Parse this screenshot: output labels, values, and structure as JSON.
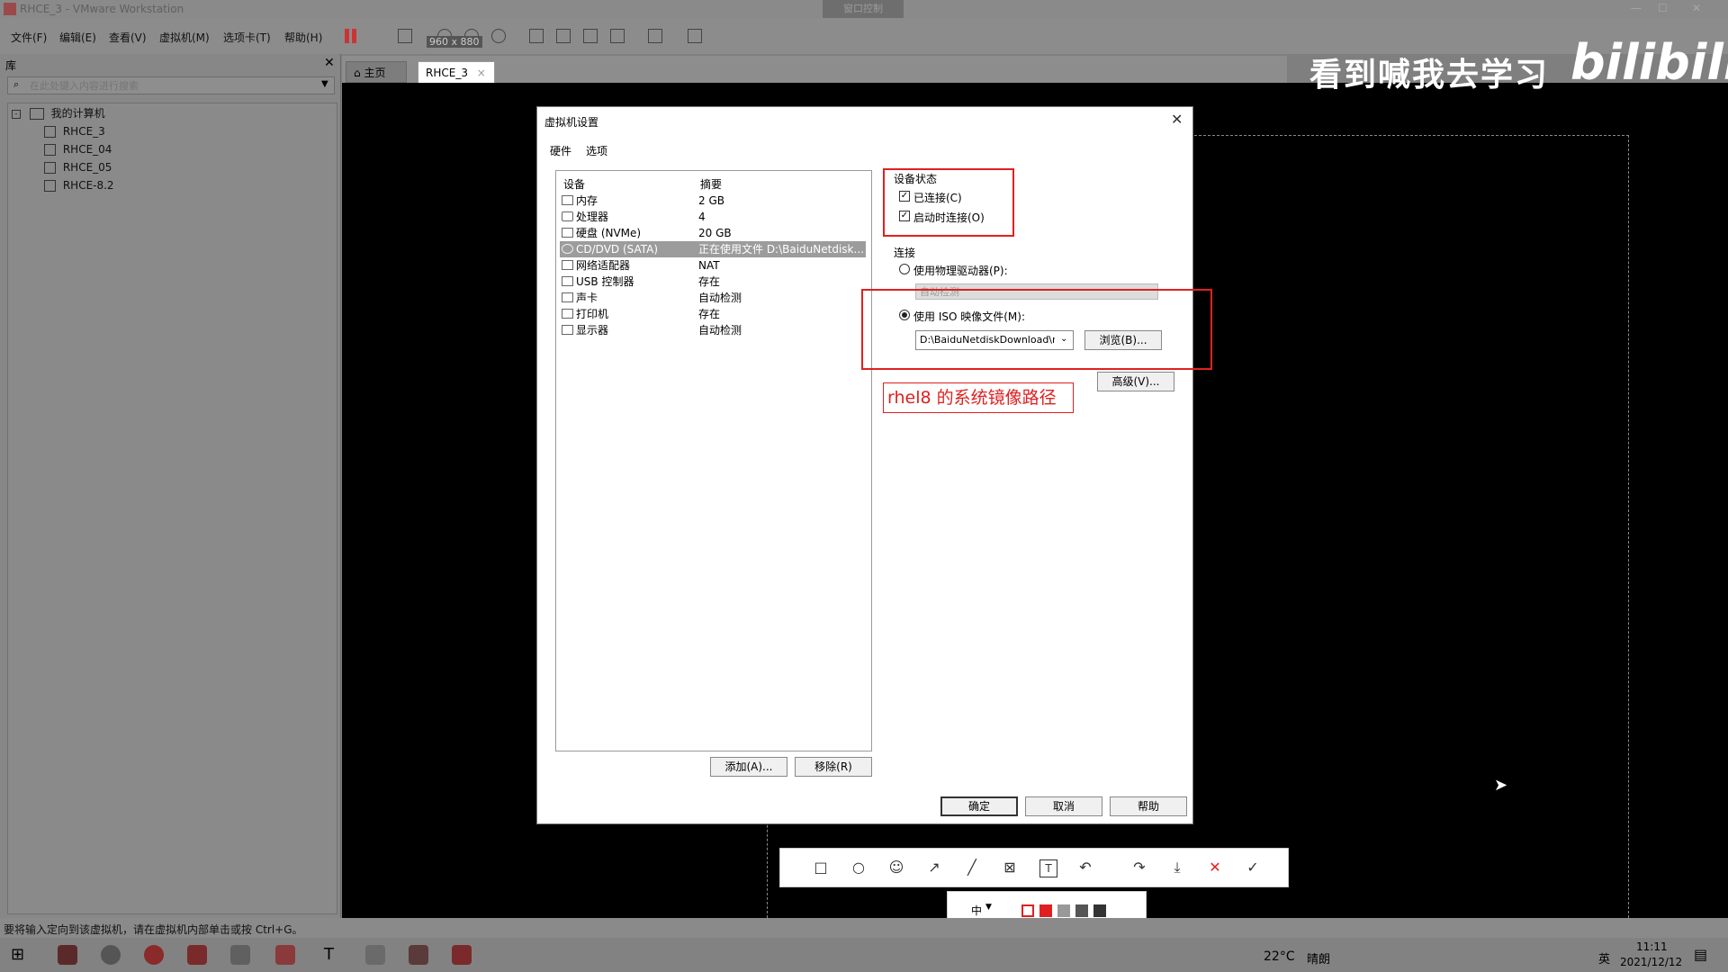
{
  "window": {
    "title": "RHCE_3 - VMware Workstation",
    "center_tab": "窗口控制"
  },
  "menu": [
    "文件(F)",
    "编辑(E)",
    "查看(V)",
    "虚拟机(M)",
    "选项卡(T)",
    "帮助(H)"
  ],
  "library": {
    "header": "库",
    "search_placeholder": "在此处键入内容进行搜索",
    "root": "我的计算机",
    "vms": [
      "RHCE_3",
      "RHCE_04",
      "RHCE_05",
      "RHCE-8.2"
    ]
  },
  "tabs": {
    "home": "主页",
    "vm": "RHCE_3"
  },
  "capture_size": "960 x 880",
  "watermark": {
    "text": "看到喊我去学习",
    "logo": "bilibili"
  },
  "dialog": {
    "title": "虚拟机设置",
    "tabs": [
      "硬件",
      "选项"
    ],
    "columns": {
      "device": "设备",
      "summary": "摘要"
    },
    "devices": [
      {
        "name": "内存",
        "summary": "2 GB",
        "icon": "memory-icon"
      },
      {
        "name": "处理器",
        "summary": "4",
        "icon": "cpu-icon"
      },
      {
        "name": "硬盘 (NVMe)",
        "summary": "20 GB",
        "icon": "disk-icon"
      },
      {
        "name": "CD/DVD (SATA)",
        "summary": "正在使用文件 D:\\BaiduNetdisk...",
        "icon": "cd-icon"
      },
      {
        "name": "网络适配器",
        "summary": "NAT",
        "icon": "network-icon"
      },
      {
        "name": "USB 控制器",
        "summary": "存在",
        "icon": "usb-icon"
      },
      {
        "name": "声卡",
        "summary": "自动检测",
        "icon": "sound-icon"
      },
      {
        "name": "打印机",
        "summary": "存在",
        "icon": "printer-icon"
      },
      {
        "name": "显示器",
        "summary": "自动检测",
        "icon": "display-icon"
      }
    ],
    "add_button": "添加(A)...",
    "remove_button": "移除(R)",
    "device_status_label": "设备状态",
    "connected_label": "已连接(C)",
    "connect_at_power_on_label": "启动时连接(O)",
    "connection_label": "连接",
    "use_physical_label": "使用物理驱动器(P):",
    "physical_value": "自动检测",
    "use_iso_label": "使用 ISO 映像文件(M):",
    "iso_path": "D:\\BaiduNetdiskDownload\\rh",
    "browse_button": "浏览(B)...",
    "advanced_button": "高级(V)...",
    "annotation": "rhel8 的系统镜像路径",
    "ok_button": "确定",
    "cancel_button": "取消",
    "help_button": "帮助"
  },
  "screenshot_tool": {
    "font_size_label": "中"
  },
  "status_message": "要将输入定向到该虚拟机，请在虚拟机内部单击或按 Ctrl+G。",
  "taskbar": {
    "temperature": "22°C",
    "weather": "晴朗",
    "ime": "英",
    "time": "11:11",
    "date": "2021/12/12"
  },
  "colors": {
    "annotation_red": "#e02020",
    "selected_row": "#9c9c9c"
  }
}
